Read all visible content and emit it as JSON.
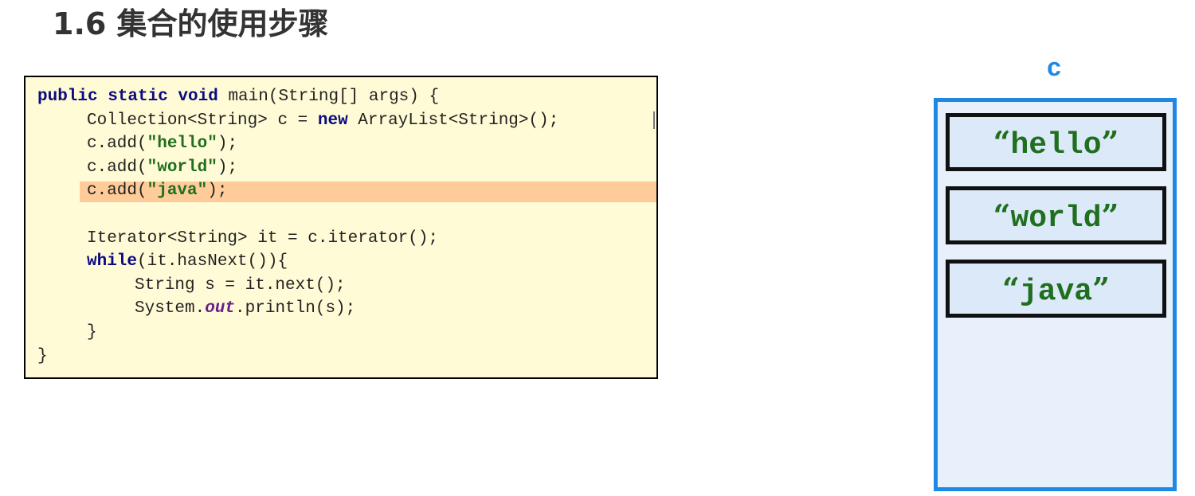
{
  "slide": {
    "title": "1.6 集合的使用步骤"
  },
  "code": {
    "l1": {
      "kw": "public static void",
      "rest": " main(String[] args) {"
    },
    "l2": {
      "a": "Collection<String> c = ",
      "kw": "new",
      "b": " ArrayList<String>();"
    },
    "l3": {
      "a": "c.add(",
      "str": "\"hello\"",
      "b": ");"
    },
    "l4": {
      "a": "c.add(",
      "str": "\"world\"",
      "b": ");"
    },
    "l5": {
      "a": "c.add(",
      "str": "\"java\"",
      "b": ");"
    },
    "l6": {
      "a": "Iterator<String> it = c.iterator();"
    },
    "l7": {
      "kw": "while",
      "b": "(it.hasNext()){"
    },
    "l8": {
      "a": "String s = it.next();"
    },
    "l9": {
      "a": "System.",
      "fld": "out",
      "b": ".println(s);"
    },
    "l10": {
      "a": "}"
    },
    "l11": {
      "a": "}"
    }
  },
  "collection": {
    "label": "c",
    "items": [
      "hello",
      "world",
      "java"
    ],
    "open_quote": "“",
    "close_quote": "”"
  }
}
